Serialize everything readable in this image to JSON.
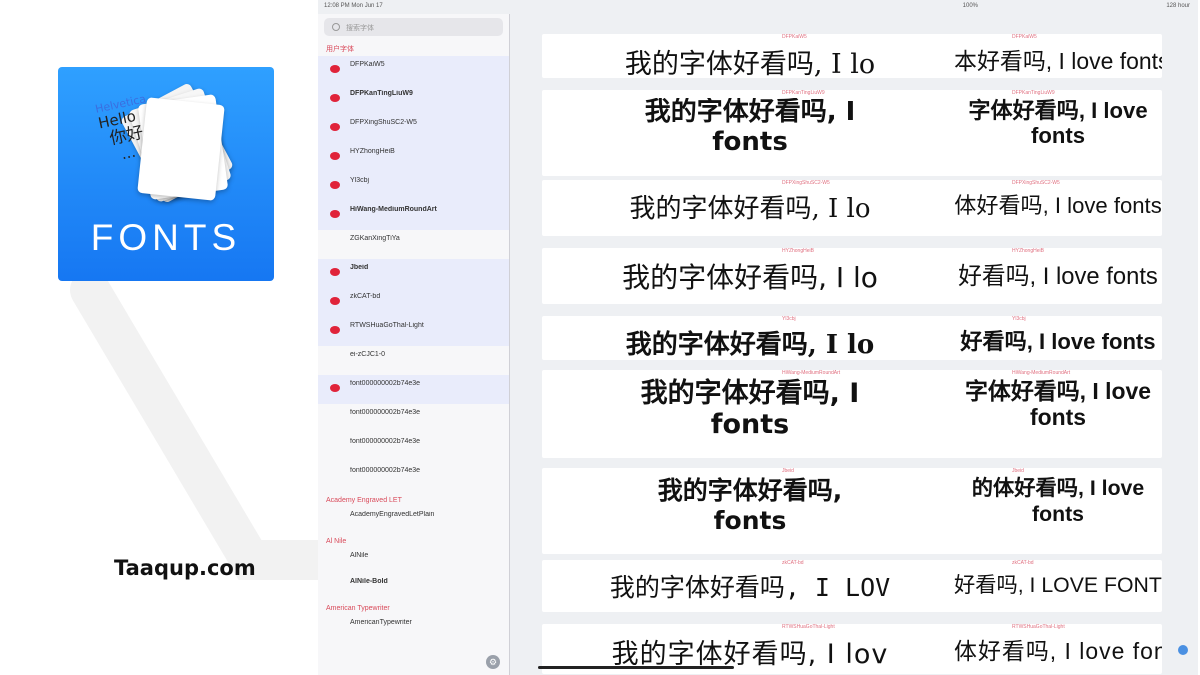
{
  "app": {
    "icon_label": "FONTS",
    "card_lines": [
      "Helvetica",
      "Hello",
      "你好",
      "..."
    ],
    "icon_colors": {
      "top": "#2fa0ff",
      "bottom": "#1677f2"
    }
  },
  "site": {
    "label": "Taaqup.com"
  },
  "ipad": {
    "status": {
      "time": "12:08 PM  Mon Jun 17",
      "wifi": "100%",
      "battery": "128 hour"
    },
    "sidebar": {
      "search_placeholder": "搜索字体",
      "section_user": "用户字体",
      "user_fonts": [
        {
          "name": "DFPKaiW5",
          "sub": "",
          "bold": false
        },
        {
          "name": "DFPKanTingLiuW9",
          "sub": "",
          "bold": true
        },
        {
          "name": "DFPXingShuSC2-W5",
          "sub": "",
          "bold": false
        },
        {
          "name": "HYZhongHeiB",
          "sub": "",
          "bold": false
        },
        {
          "name": "Yl3cbj",
          "sub": "",
          "bold": false
        },
        {
          "name": "HiWang-MediumRoundArt",
          "sub": "",
          "bold": true
        },
        {
          "name": "ZGKanXingTiYa",
          "sub": "",
          "bold": false,
          "plain": true
        },
        {
          "name": "Jbeid",
          "sub": "",
          "bold": true
        },
        {
          "name": "zkCAT-bd",
          "sub": "",
          "bold": false
        },
        {
          "name": "RTWSHuaGoThal-Light",
          "sub": "",
          "bold": false
        },
        {
          "name": "ei-zCJC1-0",
          "sub": "",
          "bold": false,
          "plain": true
        },
        {
          "name": "font000000002b74e3e",
          "sub": "",
          "bold": false
        },
        {
          "name": "font000000002b74e3e",
          "sub": "",
          "bold": false,
          "plain": true
        },
        {
          "name": "font000000002b74e3e",
          "sub": "",
          "bold": false,
          "plain": true
        },
        {
          "name": "font000000002b74e3e",
          "sub": "",
          "bold": false,
          "plain": true
        }
      ],
      "families": [
        {
          "title": "Academy Engraved LET",
          "items": [
            "AcademyEngravedLetPlain"
          ]
        },
        {
          "title": "Al Nile",
          "items": [
            "AlNile",
            "AlNile-Bold"
          ]
        },
        {
          "title": "American Typewriter",
          "items": [
            "AmericanTypewriter"
          ]
        }
      ]
    },
    "samples": [
      {
        "left": "我的字体好看吗, I lo",
        "right": "本好看吗, I love fonts",
        "cap_a": "DFPKaiW5",
        "cap_b": "DFPKaiW5"
      },
      {
        "left": "我的字体好看吗, I",
        "left2": "fonts",
        "right": "字体好看吗, I love",
        "right2": "fonts",
        "cap_a": "DFPKanTingLiuW9",
        "cap_b": "DFPKanTingLiuW9"
      },
      {
        "left": "我的字体好看吗, I lo",
        "right": "体好看吗, I love fonts",
        "cap_a": "DFPXingShuSC2-W5",
        "cap_b": "DFPXingShuSC2-W5"
      },
      {
        "left": "我的字体好看吗, I lo",
        "right": "好看吗, I love fonts",
        "cap_a": "HYZhongHeiB",
        "cap_b": "HYZhongHeiB"
      },
      {
        "left": "我的字体好看吗, I lo",
        "right": "好看吗, I love fonts",
        "cap_a": "Yl3cbj",
        "cap_b": "Yl3cbj"
      },
      {
        "left": "我的字体好看吗, I",
        "left2": "fonts",
        "right": "字体好看吗, I love",
        "right2": "fonts",
        "cap_a": "HiWang-MediumRoundArt",
        "cap_b": "HiWang-MediumRoundArt"
      },
      {
        "left": "我的字体好看吗,",
        "left2": "fonts",
        "right": "的体好看吗, I love",
        "right2": "fonts",
        "cap_a": "Jbeid",
        "cap_b": "Jbeid"
      },
      {
        "left": "我的字体好看吗, I LOV",
        "right": "好看吗, I LOVE FONTS",
        "cap_a": "zkCAT-bd",
        "cap_b": "zkCAT-bd"
      },
      {
        "left": "我的字体好看吗, I lov",
        "right": "体好看吗, I love fonts",
        "cap_a": "RTWSHuaGoThal-Light",
        "cap_b": "RTWSHuaGoThal-Light"
      }
    ]
  }
}
